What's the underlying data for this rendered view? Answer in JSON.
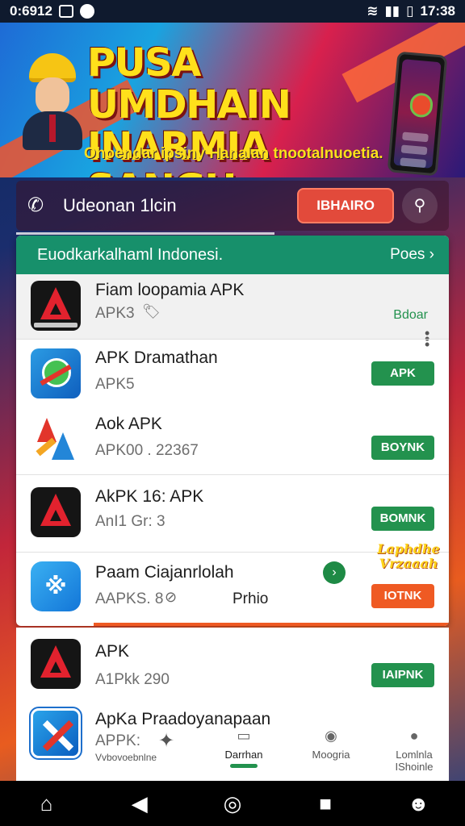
{
  "status_bar": {
    "time_left": "0:6912",
    "time_right": "17:38"
  },
  "banner": {
    "title_line1": "PUSA UMDHAIN",
    "title_line2": "INARMIA SANGH",
    "subtitle": "Ohoendar ipsiny Hanalan tnootalnuoetia."
  },
  "search": {
    "text": "Udeonan 1lcin",
    "button": "IBHAIRO"
  },
  "section": {
    "title": "Euodkarkalhaml Indonesi.",
    "more": "Poes"
  },
  "apps": [
    {
      "name": "Fiam loopamia APK",
      "meta": "APK3",
      "action": "Bdoar"
    },
    {
      "name": "APK Dramathan",
      "meta": "APK5",
      "action": "APK"
    },
    {
      "name": "Aok APK",
      "meta": "APK00 . 22367",
      "action": "BOYNK"
    },
    {
      "name": "AkPK     16: APK",
      "meta": "AnI1 Gr:   3",
      "action": "BOMNK"
    },
    {
      "name": "Paam Ciajanrlolah",
      "meta": "AAPKS. 8",
      "extra": "Prhio",
      "action": "IOTNK",
      "badge": "Laphdhe Vrzaaah"
    },
    {
      "name": "APK",
      "meta": "A1Pkk 290",
      "action": "IAIPNK"
    },
    {
      "name": "ApKa Praadoyanapaan",
      "meta": "APPK:",
      "meta2": "Vvbovoebnlne"
    }
  ],
  "tabs": [
    {
      "label": "Darrhan",
      "icon": "book-icon"
    },
    {
      "label": "Moogria",
      "icon": "camera-icon"
    },
    {
      "label": "Lomlnla IShoinle",
      "icon": "user-icon"
    }
  ],
  "colors": {
    "green": "#23924e",
    "orange": "#ef5a23",
    "header_green": "#17906b",
    "title_yellow": "#ffe01b"
  }
}
